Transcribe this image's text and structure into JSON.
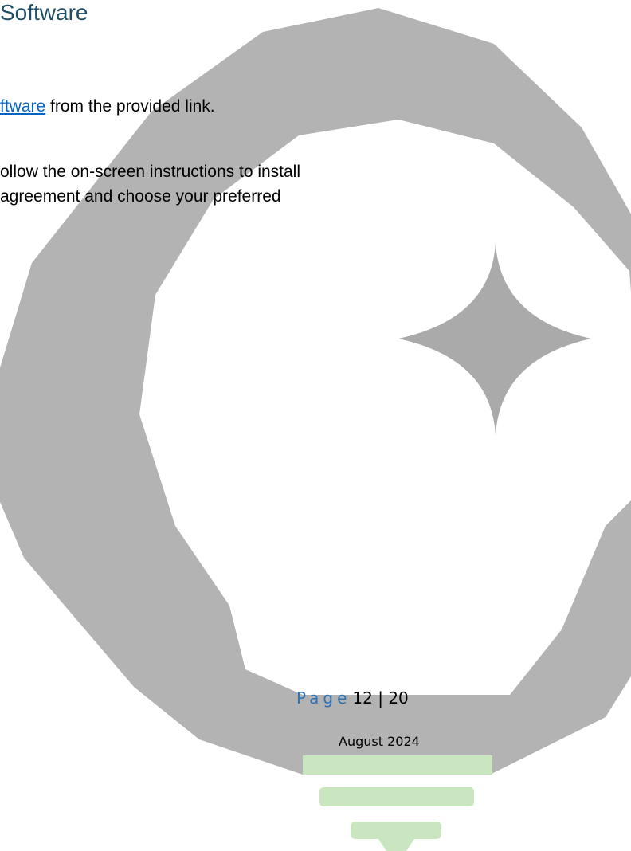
{
  "heading": "Software",
  "paragraph_1": {
    "link_text": "ftware",
    "text_after": " from the provided link."
  },
  "paragraph_2": {
    "line_1": "ollow the on-screen instructions to install",
    "line_2": " agreement and choose your preferred"
  },
  "footer": {
    "page_label": "Page",
    "page_value": "12 | 20",
    "date": "August 2024"
  },
  "colors": {
    "heading": "#1f4e66",
    "link": "#0563c1",
    "page_label": "#2e74b5",
    "watermark_ring": "#b3b3b3",
    "watermark_sparkle": "#aaaaaa",
    "bulb_base": "#c9e6c0"
  },
  "icons": {
    "watermark": "lightbulb-icon",
    "sparkle": "sparkle-icon"
  }
}
